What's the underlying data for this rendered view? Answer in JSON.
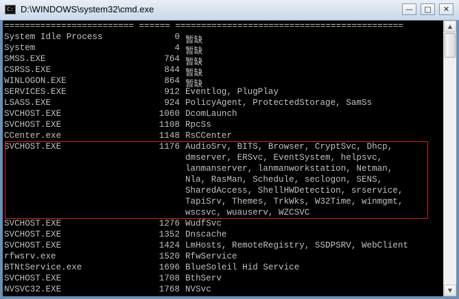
{
  "window": {
    "title": "D:\\WINDOWS\\system32\\cmd.exe",
    "icon": "cmd-icon",
    "controls": {
      "minimize": "—",
      "maximize": "□",
      "close": "✕"
    }
  },
  "console": {
    "separator": "========================= ====== ============================================",
    "rows": [
      {
        "name": "System Idle Process",
        "pid": "0",
        "services": "暂缺"
      },
      {
        "name": "System",
        "pid": "4",
        "services": "暂缺"
      },
      {
        "name": "SMSS.EXE",
        "pid": "764",
        "services": "暂缺"
      },
      {
        "name": "CSRSS.EXE",
        "pid": "844",
        "services": "暂缺"
      },
      {
        "name": "WINLOGON.EXE",
        "pid": "864",
        "services": "暂缺"
      },
      {
        "name": "SERVICES.EXE",
        "pid": "912",
        "services": "Eventlog, PlugPlay"
      },
      {
        "name": "LSASS.EXE",
        "pid": "924",
        "services": "PolicyAgent, ProtectedStorage, SamSs"
      },
      {
        "name": "SVCHOST.EXE",
        "pid": "1060",
        "services": "DcomLaunch"
      },
      {
        "name": "SVCHOST.EXE",
        "pid": "1108",
        "services": "RpcSs"
      },
      {
        "name": "CCenter.exe",
        "pid": "1148",
        "services": "RsCCenter"
      },
      {
        "name": "SVCHOST.EXE",
        "pid": "1176",
        "services": "AudioSrv, BITS, Browser, CryptSvc, Dhcp,"
      },
      {
        "name": "",
        "pid": "",
        "services": "dmserver, ERSvc, EventSystem, helpsvc,"
      },
      {
        "name": "",
        "pid": "",
        "services": "lanmanserver, lanmanworkstation, Netman,"
      },
      {
        "name": "",
        "pid": "",
        "services": "Nla, RasMan, Schedule, seclogon, SENS,"
      },
      {
        "name": "",
        "pid": "",
        "services": "SharedAccess, ShellHWDetection, srservice,"
      },
      {
        "name": "",
        "pid": "",
        "services": "TapiSrv, Themes, TrkWks, W32Time, winmgmt,"
      },
      {
        "name": "",
        "pid": "",
        "services": "wscsvc, wuauserv, WZCSVC"
      },
      {
        "name": "SVCHOST.EXE",
        "pid": "1276",
        "services": "WudfSvc"
      },
      {
        "name": "SVCHOST.EXE",
        "pid": "1352",
        "services": "Dnscache"
      },
      {
        "name": "SVCHOST.EXE",
        "pid": "1424",
        "services": "LmHosts, RemoteRegistry, SSDPSRV, WebClient"
      },
      {
        "name": "rfwsrv.exe",
        "pid": "1520",
        "services": "RfwService"
      },
      {
        "name": "BTNtService.exe",
        "pid": "1696",
        "services": "BlueSoleil Hid Service"
      },
      {
        "name": "SVCHOST.EXE",
        "pid": "1708",
        "services": "BthServ"
      },
      {
        "name": "NVSVC32.EXE",
        "pid": "1768",
        "services": "NVSvc"
      }
    ]
  },
  "colors": {
    "console_bg": "#000000",
    "console_fg": "#c0c0c0",
    "highlight": "#e02020"
  }
}
